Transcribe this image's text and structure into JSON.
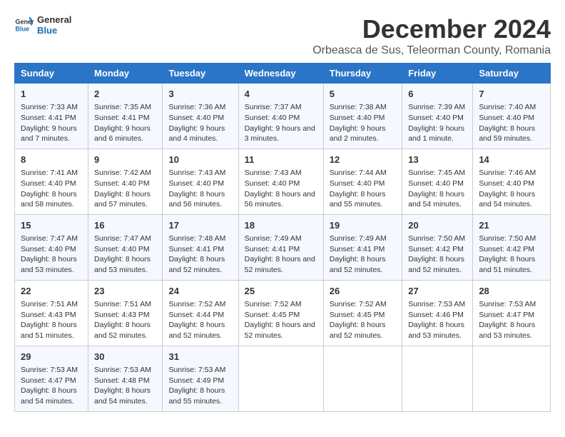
{
  "logo": {
    "general": "General",
    "blue": "Blue"
  },
  "title": "December 2024",
  "subtitle": "Orbeasca de Sus, Teleorman County, Romania",
  "days_of_week": [
    "Sunday",
    "Monday",
    "Tuesday",
    "Wednesday",
    "Thursday",
    "Friday",
    "Saturday"
  ],
  "weeks": [
    [
      {
        "day": "1",
        "sunrise": "Sunrise: 7:33 AM",
        "sunset": "Sunset: 4:41 PM",
        "daylight": "Daylight: 9 hours and 7 minutes."
      },
      {
        "day": "2",
        "sunrise": "Sunrise: 7:35 AM",
        "sunset": "Sunset: 4:41 PM",
        "daylight": "Daylight: 9 hours and 6 minutes."
      },
      {
        "day": "3",
        "sunrise": "Sunrise: 7:36 AM",
        "sunset": "Sunset: 4:40 PM",
        "daylight": "Daylight: 9 hours and 4 minutes."
      },
      {
        "day": "4",
        "sunrise": "Sunrise: 7:37 AM",
        "sunset": "Sunset: 4:40 PM",
        "daylight": "Daylight: 9 hours and 3 minutes."
      },
      {
        "day": "5",
        "sunrise": "Sunrise: 7:38 AM",
        "sunset": "Sunset: 4:40 PM",
        "daylight": "Daylight: 9 hours and 2 minutes."
      },
      {
        "day": "6",
        "sunrise": "Sunrise: 7:39 AM",
        "sunset": "Sunset: 4:40 PM",
        "daylight": "Daylight: 9 hours and 1 minute."
      },
      {
        "day": "7",
        "sunrise": "Sunrise: 7:40 AM",
        "sunset": "Sunset: 4:40 PM",
        "daylight": "Daylight: 8 hours and 59 minutes."
      }
    ],
    [
      {
        "day": "8",
        "sunrise": "Sunrise: 7:41 AM",
        "sunset": "Sunset: 4:40 PM",
        "daylight": "Daylight: 8 hours and 58 minutes."
      },
      {
        "day": "9",
        "sunrise": "Sunrise: 7:42 AM",
        "sunset": "Sunset: 4:40 PM",
        "daylight": "Daylight: 8 hours and 57 minutes."
      },
      {
        "day": "10",
        "sunrise": "Sunrise: 7:43 AM",
        "sunset": "Sunset: 4:40 PM",
        "daylight": "Daylight: 8 hours and 56 minutes."
      },
      {
        "day": "11",
        "sunrise": "Sunrise: 7:43 AM",
        "sunset": "Sunset: 4:40 PM",
        "daylight": "Daylight: 8 hours and 56 minutes."
      },
      {
        "day": "12",
        "sunrise": "Sunrise: 7:44 AM",
        "sunset": "Sunset: 4:40 PM",
        "daylight": "Daylight: 8 hours and 55 minutes."
      },
      {
        "day": "13",
        "sunrise": "Sunrise: 7:45 AM",
        "sunset": "Sunset: 4:40 PM",
        "daylight": "Daylight: 8 hours and 54 minutes."
      },
      {
        "day": "14",
        "sunrise": "Sunrise: 7:46 AM",
        "sunset": "Sunset: 4:40 PM",
        "daylight": "Daylight: 8 hours and 54 minutes."
      }
    ],
    [
      {
        "day": "15",
        "sunrise": "Sunrise: 7:47 AM",
        "sunset": "Sunset: 4:40 PM",
        "daylight": "Daylight: 8 hours and 53 minutes."
      },
      {
        "day": "16",
        "sunrise": "Sunrise: 7:47 AM",
        "sunset": "Sunset: 4:40 PM",
        "daylight": "Daylight: 8 hours and 53 minutes."
      },
      {
        "day": "17",
        "sunrise": "Sunrise: 7:48 AM",
        "sunset": "Sunset: 4:41 PM",
        "daylight": "Daylight: 8 hours and 52 minutes."
      },
      {
        "day": "18",
        "sunrise": "Sunrise: 7:49 AM",
        "sunset": "Sunset: 4:41 PM",
        "daylight": "Daylight: 8 hours and 52 minutes."
      },
      {
        "day": "19",
        "sunrise": "Sunrise: 7:49 AM",
        "sunset": "Sunset: 4:41 PM",
        "daylight": "Daylight: 8 hours and 52 minutes."
      },
      {
        "day": "20",
        "sunrise": "Sunrise: 7:50 AM",
        "sunset": "Sunset: 4:42 PM",
        "daylight": "Daylight: 8 hours and 52 minutes."
      },
      {
        "day": "21",
        "sunrise": "Sunrise: 7:50 AM",
        "sunset": "Sunset: 4:42 PM",
        "daylight": "Daylight: 8 hours and 51 minutes."
      }
    ],
    [
      {
        "day": "22",
        "sunrise": "Sunrise: 7:51 AM",
        "sunset": "Sunset: 4:43 PM",
        "daylight": "Daylight: 8 hours and 51 minutes."
      },
      {
        "day": "23",
        "sunrise": "Sunrise: 7:51 AM",
        "sunset": "Sunset: 4:43 PM",
        "daylight": "Daylight: 8 hours and 52 minutes."
      },
      {
        "day": "24",
        "sunrise": "Sunrise: 7:52 AM",
        "sunset": "Sunset: 4:44 PM",
        "daylight": "Daylight: 8 hours and 52 minutes."
      },
      {
        "day": "25",
        "sunrise": "Sunrise: 7:52 AM",
        "sunset": "Sunset: 4:45 PM",
        "daylight": "Daylight: 8 hours and 52 minutes."
      },
      {
        "day": "26",
        "sunrise": "Sunrise: 7:52 AM",
        "sunset": "Sunset: 4:45 PM",
        "daylight": "Daylight: 8 hours and 52 minutes."
      },
      {
        "day": "27",
        "sunrise": "Sunrise: 7:53 AM",
        "sunset": "Sunset: 4:46 PM",
        "daylight": "Daylight: 8 hours and 53 minutes."
      },
      {
        "day": "28",
        "sunrise": "Sunrise: 7:53 AM",
        "sunset": "Sunset: 4:47 PM",
        "daylight": "Daylight: 8 hours and 53 minutes."
      }
    ],
    [
      {
        "day": "29",
        "sunrise": "Sunrise: 7:53 AM",
        "sunset": "Sunset: 4:47 PM",
        "daylight": "Daylight: 8 hours and 54 minutes."
      },
      {
        "day": "30",
        "sunrise": "Sunrise: 7:53 AM",
        "sunset": "Sunset: 4:48 PM",
        "daylight": "Daylight: 8 hours and 54 minutes."
      },
      {
        "day": "31",
        "sunrise": "Sunrise: 7:53 AM",
        "sunset": "Sunset: 4:49 PM",
        "daylight": "Daylight: 8 hours and 55 minutes."
      },
      null,
      null,
      null,
      null
    ]
  ]
}
